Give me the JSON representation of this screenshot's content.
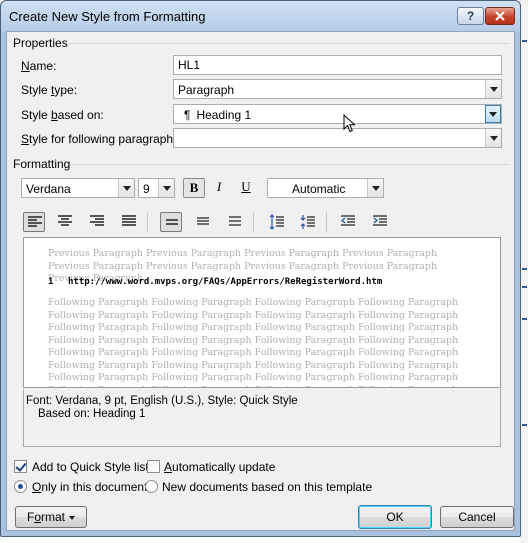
{
  "window": {
    "title": "Create New Style from Formatting",
    "help_label": "?",
    "close_label": "X"
  },
  "properties": {
    "section_label": "Properties",
    "name_label_pre": "",
    "name_label_u": "N",
    "name_label_post": "ame:",
    "name_value": "HL1",
    "style_type_label_pre": "Style ",
    "style_type_label_u": "t",
    "style_type_label_post": "ype:",
    "style_type_value": "Paragraph",
    "based_on_label_pre": "Style ",
    "based_on_label_u": "b",
    "based_on_label_post": "ased on:",
    "based_on_icon": "¶",
    "based_on_value": "Heading 1",
    "following_label_pre": "",
    "following_label_u": "S",
    "following_label_post": "tyle for following paragraph:",
    "following_value": ""
  },
  "formatting": {
    "section_label": "Formatting",
    "font_value": "Verdana",
    "size_value": "9",
    "bold_label": "B",
    "italic_label": "I",
    "underline_label": "U",
    "color_value": "Automatic"
  },
  "preview": {
    "previous_text": "Previous Paragraph Previous Paragraph Previous Paragraph Previous Paragraph Previous Paragraph Previous Paragraph Previous Paragraph Previous Paragraph Previous Paragraph",
    "list_number": "1",
    "sample_text": "http://www.word.mvps.org/FAQs/AppErrors/ReRegisterWord.htm",
    "following_text": "Following Paragraph Following Paragraph Following Paragraph Following Paragraph Following Paragraph Following Paragraph Following Paragraph Following Paragraph Following Paragraph Following Paragraph Following Paragraph Following Paragraph Following Paragraph Following Paragraph Following Paragraph Following Paragraph Following Paragraph Following Paragraph Following Paragraph Following Paragraph Following Paragraph Following Paragraph Following Paragraph Following Paragraph Following Paragraph Following Paragraph Following Paragraph Following Paragraph Following Paragraph Following Paragraph Following Paragraph Following Paragraph Following Paragraph Following Paragraph Following Paragraph"
  },
  "description": {
    "line1": "Font: Verdana, 9 pt, English (U.S.), Style: Quick Style",
    "line2": "Based on: Heading 1"
  },
  "options": {
    "add_quick_style_label": "Add to Quick Style list",
    "add_quick_style_checked": true,
    "auto_update_label_pre": "",
    "auto_update_label_u": "A",
    "auto_update_label_post": "utomatically update",
    "auto_update_checked": false,
    "only_this_doc_label_pre": "",
    "only_this_doc_label_u": "O",
    "only_this_doc_label_post": "nly in this document",
    "new_docs_label": "New documents based on this template"
  },
  "buttons": {
    "format_label_pre": "F",
    "format_label_u": "o",
    "format_label_post": "rmat",
    "ok_label": "OK",
    "cancel_label": "Cancel"
  },
  "colors": {
    "title_gradient_top": "#cfe0f3",
    "client_bg": "#f0f0f0",
    "close_red": "#c7432b",
    "focus_blue": "#3c7fb1"
  }
}
